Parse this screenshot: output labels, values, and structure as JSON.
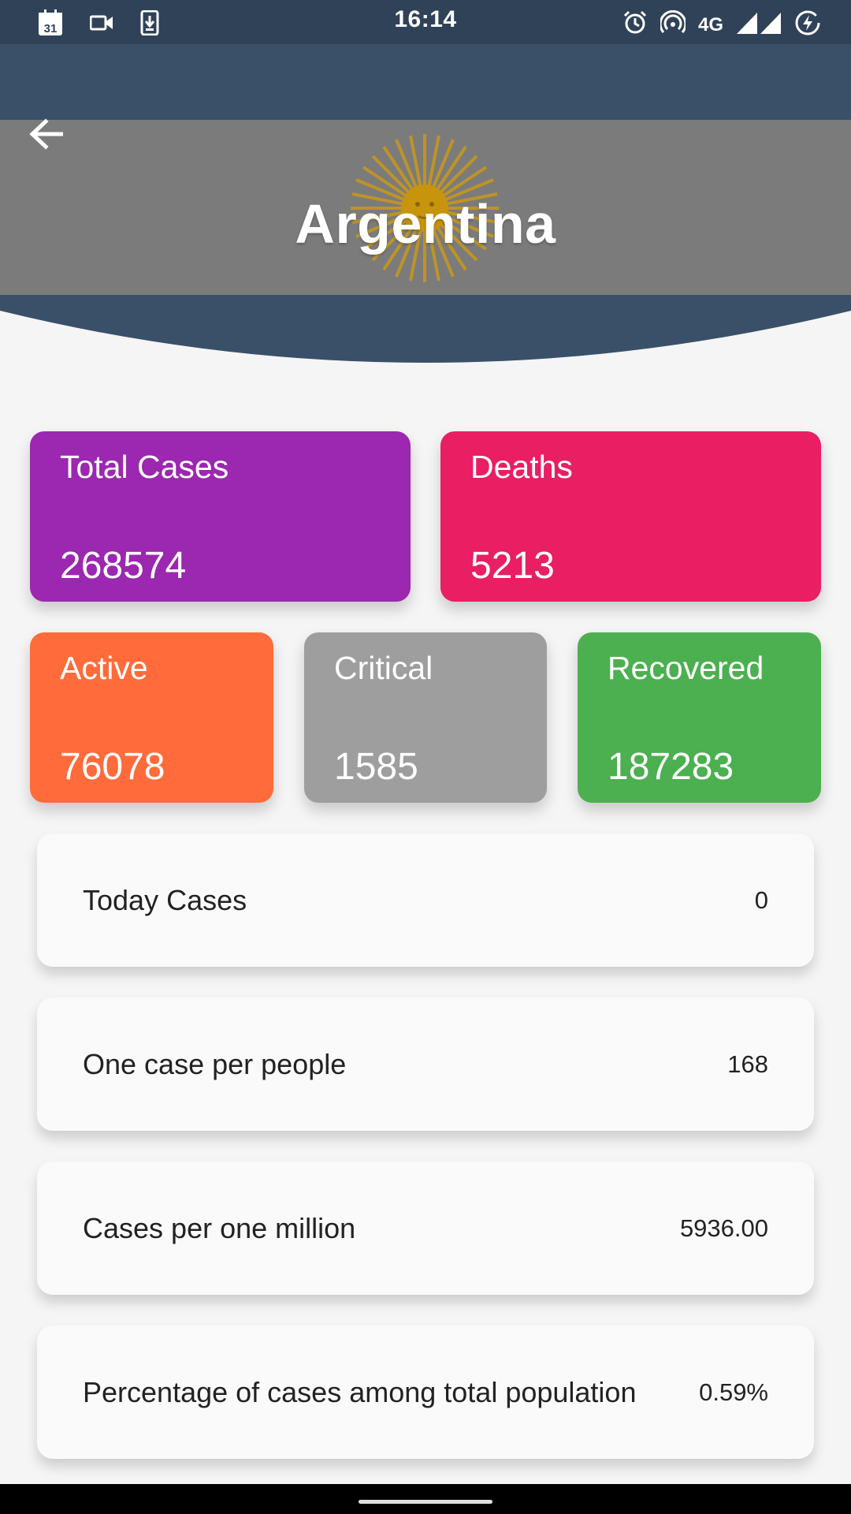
{
  "status_bar": {
    "time": "16:14",
    "calendar_day": "31",
    "network": "4G",
    "icons": [
      "calendar-icon",
      "video-camera-icon",
      "download-icon",
      "alarm-icon",
      "hotspot-icon",
      "signal-icon",
      "battery-saver-icon"
    ]
  },
  "header": {
    "back_icon": "arrow-back-icon",
    "country": "Argentina",
    "colors": {
      "header_bg": "#3a5068",
      "flag_band": "#7b7b7b",
      "sun": "#d4a017"
    }
  },
  "stats": {
    "total_cases": {
      "label": "Total Cases",
      "value": "268574",
      "color": "#9c27b0"
    },
    "deaths": {
      "label": "Deaths",
      "value": "5213",
      "color": "#e91e63"
    },
    "active": {
      "label": "Active",
      "value": "76078",
      "color": "#ff6b3a"
    },
    "critical": {
      "label": "Critical",
      "value": "1585",
      "color": "#9e9e9e"
    },
    "recovered": {
      "label": "Recovered",
      "value": "187283",
      "color": "#4caf50"
    }
  },
  "details": [
    {
      "label": "Today Cases",
      "value": "0"
    },
    {
      "label": "One case per people",
      "value": "168"
    },
    {
      "label": "Cases per one million",
      "value": "5936.00"
    },
    {
      "label": "Percentage of cases among total population",
      "value": "0.59%"
    }
  ]
}
